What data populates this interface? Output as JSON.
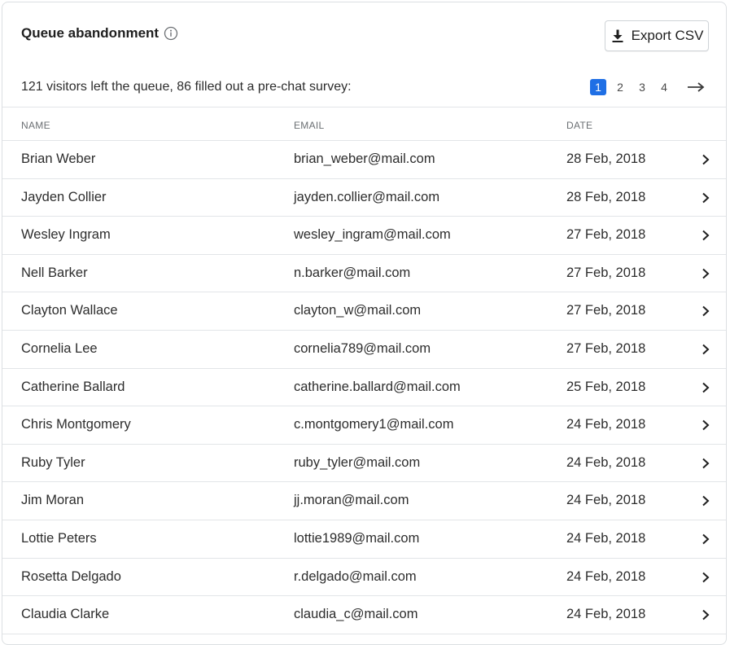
{
  "header": {
    "title": "Queue abandonment",
    "export_label": "Export CSV"
  },
  "summary": "121 visitors left the queue, 86 filled out a pre-chat survey:",
  "pagination": {
    "pages": [
      "1",
      "2",
      "3",
      "4"
    ],
    "active": "1"
  },
  "table": {
    "columns": {
      "name": "NAME",
      "email": "EMAIL",
      "date": "DATE"
    },
    "rows": [
      {
        "name": "Brian Weber",
        "email": "brian_weber@mail.com",
        "date": "28 Feb, 2018"
      },
      {
        "name": "Jayden Collier",
        "email": "jayden.collier@mail.com",
        "date": "28 Feb, 2018"
      },
      {
        "name": "Wesley Ingram",
        "email": "wesley_ingram@mail.com",
        "date": "27 Feb, 2018"
      },
      {
        "name": "Nell Barker",
        "email": "n.barker@mail.com",
        "date": "27 Feb, 2018"
      },
      {
        "name": "Clayton Wallace",
        "email": "clayton_w@mail.com",
        "date": "27 Feb, 2018"
      },
      {
        "name": "Cornelia Lee",
        "email": "cornelia789@mail.com",
        "date": "27 Feb, 2018"
      },
      {
        "name": "Catherine Ballard",
        "email": "catherine.ballard@mail.com",
        "date": "25 Feb, 2018"
      },
      {
        "name": "Chris Montgomery",
        "email": "c.montgomery1@mail.com",
        "date": "24 Feb, 2018"
      },
      {
        "name": "Ruby Tyler",
        "email": "ruby_tyler@mail.com",
        "date": "24 Feb, 2018"
      },
      {
        "name": "Jim Moran",
        "email": "jj.moran@mail.com",
        "date": "24 Feb, 2018"
      },
      {
        "name": "Lottie Peters",
        "email": "lottie1989@mail.com",
        "date": "24 Feb, 2018"
      },
      {
        "name": "Rosetta Delgado",
        "email": "r.delgado@mail.com",
        "date": "24 Feb, 2018"
      },
      {
        "name": "Claudia Clarke",
        "email": "claudia_c@mail.com",
        "date": "24 Feb, 2018"
      }
    ]
  },
  "icons": {
    "info": "info-icon",
    "export": "download-icon",
    "next": "arrow-right-icon",
    "row_open": "chevron-right-icon"
  },
  "colors": {
    "accent": "#1f6fe5",
    "border": "#e2e5e8",
    "text": "#2d2d2d"
  }
}
